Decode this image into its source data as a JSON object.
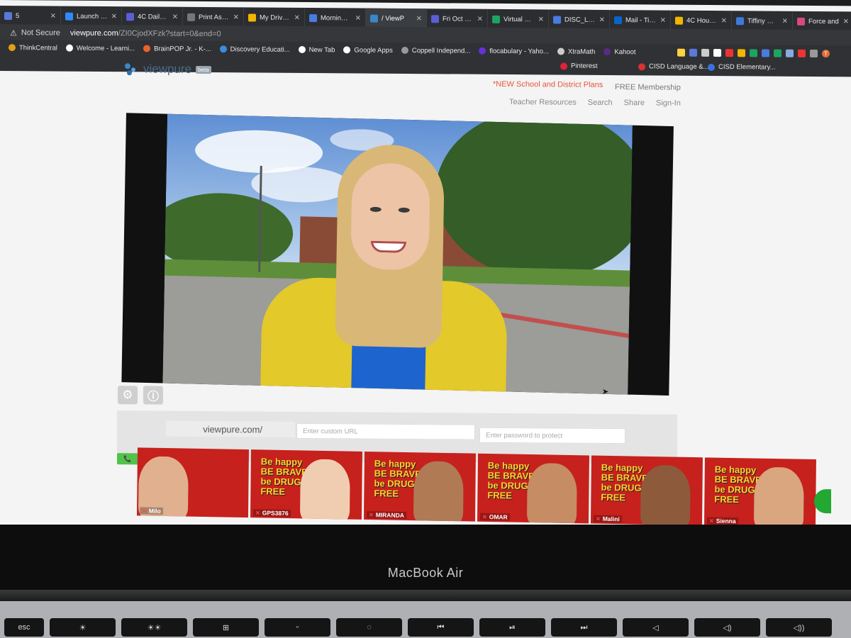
{
  "browser": {
    "tabs": [
      {
        "label": "5",
        "color": "#5b79d8",
        "active": false
      },
      {
        "label": "Launch Me",
        "color": "#2d8cff",
        "active": false
      },
      {
        "label": "4C Daily Ch",
        "color": "#5a5fd6",
        "active": false
      },
      {
        "label": "Print Asses",
        "color": "#777777",
        "active": false
      },
      {
        "label": "My Drive - (",
        "color": "#f2b600",
        "active": false
      },
      {
        "label": "Morning An",
        "color": "#4a7be0",
        "active": false
      },
      {
        "label": "/ ViewP",
        "color": "#3a86c8",
        "active": true
      },
      {
        "label": "Fri Oct 30th",
        "color": "#5a5fd6",
        "active": false
      },
      {
        "label": "Virtual MKE",
        "color": "#1ea362",
        "active": false
      },
      {
        "label": "DISC_Lang",
        "color": "#4a7be0",
        "active": false
      },
      {
        "label": "Mail - Tiffin",
        "color": "#0a64c8",
        "active": false
      },
      {
        "label": "4C Houdek",
        "color": "#f2b600",
        "active": false
      },
      {
        "label": "Tiffiny Hou",
        "color": "#3d7bd8",
        "active": false
      },
      {
        "label": "Force and",
        "color": "#d64a7c",
        "active": false
      }
    ],
    "new_tab_symbol": "+",
    "not_secure": "Not Secure",
    "url_host": "viewpure.com",
    "url_path": "/ZI0CjodXFzk?start=0&end=0",
    "bookmarks": [
      {
        "label": "ThinkCentral",
        "color": "#e0a21b"
      },
      {
        "label": "Welcome - Learni...",
        "color": "#ffffff"
      },
      {
        "label": "BrainPOP Jr. - K-...",
        "color": "#e8642a"
      },
      {
        "label": "Discovery Educati...",
        "color": "#3d8be0"
      },
      {
        "label": "New Tab",
        "color": "#ffffff"
      },
      {
        "label": "Google Apps",
        "color": "#ffffff"
      },
      {
        "label": "Coppell Independ...",
        "color": "#999999"
      },
      {
        "label": "flocabulary - Yaho...",
        "color": "#6a2fd6"
      },
      {
        "label": "XtraMath",
        "color": "#cccccc"
      },
      {
        "label": "Kahoot",
        "color": "#5b2a86"
      }
    ],
    "bookmarks_row2": [
      {
        "label": "Pinterest",
        "color": "#e0233a"
      },
      {
        "label": "CISD Language &...",
        "color": "#d9322f"
      },
      {
        "label": "CISD Elementary...",
        "color": "#3d6fe0"
      }
    ],
    "profile_initial": "T"
  },
  "page": {
    "logo_text": "viewpure",
    "logo_badge": "beta",
    "promo": "*NEW School and District Plans",
    "free_membership": "FREE Membership",
    "nav": [
      "Teacher Resources",
      "Search",
      "Share",
      "Sign-In"
    ],
    "url_prefix": "viewpure.com/",
    "custom_url_placeholder": "Enter custom URL",
    "password_placeholder": "Enter password to protect",
    "gear_icon": "gear-icon",
    "info_icon": "info-icon"
  },
  "participants": [
    {
      "name": "Milo",
      "bg": "#c6211d",
      "poster": false
    },
    {
      "name": "GPS3876",
      "bg": "#c6211d",
      "poster": true
    },
    {
      "name": "MIRANDA",
      "bg": "#c6211d",
      "poster": true
    },
    {
      "name": "OMAR",
      "bg": "#c6211d",
      "poster": true
    },
    {
      "name": "Malini",
      "bg": "#c6211d",
      "poster": true
    },
    {
      "name": "Sienna",
      "bg": "#c6211d",
      "poster": true
    }
  ],
  "poster_lines": [
    "Be happy",
    "BE BRAVE",
    "be DRUG",
    "FREE"
  ],
  "laptop": {
    "brand": "MacBook Air",
    "keys": [
      "esc",
      "☀",
      "☀☀",
      "⊞",
      "ᵕ",
      "◌",
      "⏮",
      "⏯",
      "⏭",
      "◁",
      "◁)",
      "◁))"
    ]
  },
  "colors": {
    "accent_orange": "#e8543a",
    "zoom_red": "#c6211d",
    "green": "#4fc34a"
  }
}
